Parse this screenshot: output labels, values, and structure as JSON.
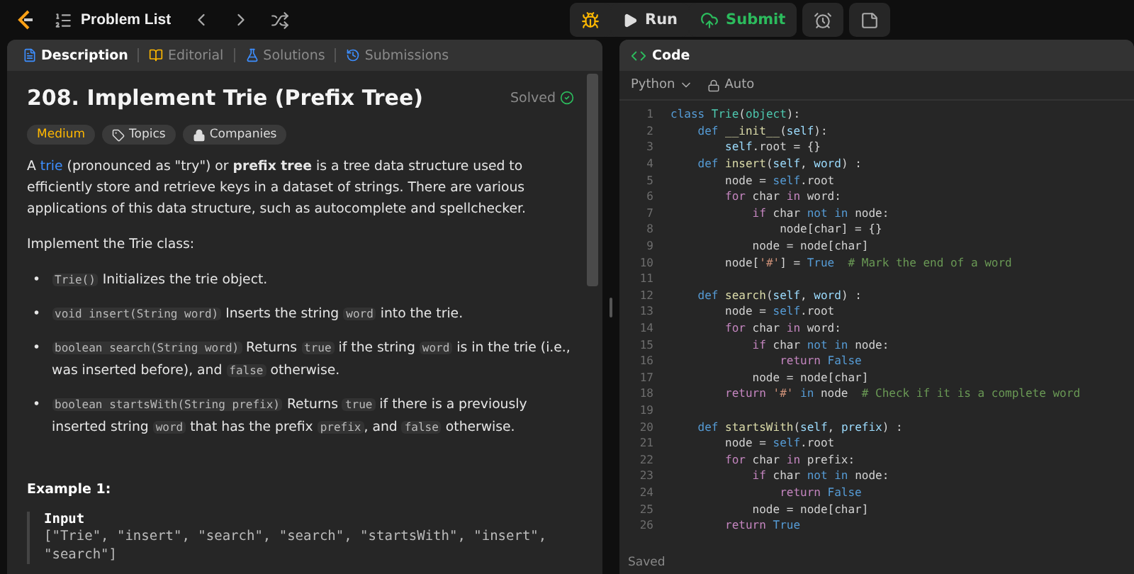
{
  "top_bar": {
    "problem_list": "Problem List",
    "run": "Run",
    "submit": "Submit"
  },
  "description_panel": {
    "tabs": [
      {
        "label": "Description",
        "selected": true
      },
      {
        "label": "Editorial",
        "selected": false
      },
      {
        "label": "Solutions",
        "selected": false
      },
      {
        "label": "Submissions",
        "selected": false
      }
    ],
    "title": "208. Implement Trie (Prefix Tree)",
    "status": "Solved",
    "tags": [
      {
        "label": "Medium",
        "kind": "difficulty"
      },
      {
        "label": "Topics",
        "kind": "topics"
      },
      {
        "label": "Companies",
        "kind": "companies"
      }
    ],
    "intro": [
      {
        "text": "A "
      },
      {
        "text": "trie",
        "kind": "link"
      },
      {
        "text": " (pronounced as \"try\") or "
      },
      {
        "text": "prefix tree",
        "kind": "bold"
      },
      {
        "text": " is a tree data structure used to efficiently store and retrieve keys in a dataset of strings. There are various applications of this data structure, such as autocomplete and spellchecker."
      }
    ],
    "implement_text": "Implement the Trie class:",
    "bullets": [
      {
        "marker": "•",
        "parts": [
          {
            "text": "Trie()",
            "kind": "code"
          },
          {
            "text": " Initializes the trie object."
          }
        ]
      },
      {
        "marker": "•",
        "parts": [
          {
            "text": "void insert(String word)",
            "kind": "code"
          },
          {
            "text": " Inserts the string "
          },
          {
            "text": "word",
            "kind": "code"
          },
          {
            "text": " into the trie."
          }
        ]
      },
      {
        "marker": "•",
        "parts": [
          {
            "text": "boolean search(String word)",
            "kind": "code"
          },
          {
            "text": " Returns "
          },
          {
            "text": "true",
            "kind": "code"
          },
          {
            "text": " if the string "
          },
          {
            "text": "word",
            "kind": "code"
          },
          {
            "text": " is in the trie (i.e., was inserted before), and "
          },
          {
            "text": "false",
            "kind": "code"
          },
          {
            "text": " otherwise."
          }
        ]
      },
      {
        "marker": "•",
        "parts": [
          {
            "text": "boolean startsWith(String prefix)",
            "kind": "code"
          },
          {
            "text": " Returns "
          },
          {
            "text": "true",
            "kind": "code"
          },
          {
            "text": " if there is a previously inserted string "
          },
          {
            "text": "word",
            "kind": "code"
          },
          {
            "text": " that has the prefix "
          },
          {
            "text": "prefix",
            "kind": "code"
          },
          {
            "text": ", and "
          },
          {
            "text": "false",
            "kind": "code"
          },
          {
            "text": " otherwise."
          }
        ]
      }
    ],
    "example": {
      "heading": "Example 1:",
      "input_label": "Input",
      "input_lines": [
        "[\"Trie\", \"insert\", \"search\", \"search\", \"startsWith\", \"insert\",",
        "\"search\"]"
      ]
    }
  },
  "code_panel": {
    "title": "Code",
    "language": "Python",
    "mode": "Auto",
    "status": "Saved",
    "lines": [
      {
        "n": "1",
        "tokens": [
          {
            "kind": "kw",
            "text": "class "
          },
          {
            "kind": "cls",
            "text": "Trie"
          },
          {
            "kind": "p",
            "text": "("
          },
          {
            "kind": "cls",
            "text": "object"
          },
          {
            "kind": "p",
            "text": "):"
          }
        ]
      },
      {
        "n": "2",
        "tokens": [
          {
            "kind": "kw",
            "text": "    def "
          },
          {
            "kind": "fn",
            "text": "__init__"
          },
          {
            "kind": "p",
            "text": "("
          },
          {
            "kind": "var",
            "text": "self"
          },
          {
            "kind": "p",
            "text": "):"
          }
        ]
      },
      {
        "n": "3",
        "tokens": [
          {
            "kind": "var",
            "text": "        self"
          },
          {
            "kind": "p",
            "text": ".root = {}"
          }
        ]
      },
      {
        "n": "4",
        "tokens": [
          {
            "kind": "kw",
            "text": "    def "
          },
          {
            "kind": "fn",
            "text": "insert"
          },
          {
            "kind": "p",
            "text": "("
          },
          {
            "kind": "var",
            "text": "self"
          },
          {
            "kind": "p",
            "text": ", "
          },
          {
            "kind": "var",
            "text": "word"
          },
          {
            "kind": "p",
            "text": ") :"
          }
        ]
      },
      {
        "n": "5",
        "tokens": [
          {
            "kind": "p",
            "text": "        node = "
          },
          {
            "kind": "kw",
            "text": "self"
          },
          {
            "kind": "p",
            "text": ".root"
          }
        ]
      },
      {
        "n": "6",
        "tokens": [
          {
            "kind": "ctl",
            "text": "        for"
          },
          {
            "kind": "p",
            "text": " char "
          },
          {
            "kind": "ctl",
            "text": "in"
          },
          {
            "kind": "p",
            "text": " word:"
          }
        ]
      },
      {
        "n": "7",
        "tokens": [
          {
            "kind": "ctl",
            "text": "            if"
          },
          {
            "kind": "p",
            "text": " char "
          },
          {
            "kind": "kw",
            "text": "not in"
          },
          {
            "kind": "p",
            "text": " node:"
          }
        ]
      },
      {
        "n": "8",
        "tokens": [
          {
            "kind": "p",
            "text": "                node[char] = {}"
          }
        ]
      },
      {
        "n": "9",
        "tokens": [
          {
            "kind": "p",
            "text": "            node = node[char]"
          }
        ]
      },
      {
        "n": "10",
        "tokens": [
          {
            "kind": "p",
            "text": "        node["
          },
          {
            "kind": "str",
            "text": "'#'"
          },
          {
            "kind": "p",
            "text": "] = "
          },
          {
            "kind": "kw",
            "text": "True"
          },
          {
            "kind": "com",
            "text": "  # Mark the end of a word"
          }
        ]
      },
      {
        "n": "11"
      },
      {
        "n": "12",
        "tokens": [
          {
            "kind": "kw",
            "text": "    def "
          },
          {
            "kind": "fn",
            "text": "search"
          },
          {
            "kind": "p",
            "text": "("
          },
          {
            "kind": "var",
            "text": "self"
          },
          {
            "kind": "p",
            "text": ", "
          },
          {
            "kind": "var",
            "text": "word"
          },
          {
            "kind": "p",
            "text": ") :"
          }
        ]
      },
      {
        "n": "13",
        "tokens": [
          {
            "kind": "p",
            "text": "        node = "
          },
          {
            "kind": "kw",
            "text": "self"
          },
          {
            "kind": "p",
            "text": ".root"
          }
        ]
      },
      {
        "n": "14",
        "tokens": [
          {
            "kind": "ctl",
            "text": "        for"
          },
          {
            "kind": "p",
            "text": " char "
          },
          {
            "kind": "ctl",
            "text": "in"
          },
          {
            "kind": "p",
            "text": " word:"
          }
        ]
      },
      {
        "n": "15",
        "tokens": [
          {
            "kind": "ctl",
            "text": "            if"
          },
          {
            "kind": "p",
            "text": " char "
          },
          {
            "kind": "kw",
            "text": "not in"
          },
          {
            "kind": "p",
            "text": " node:"
          }
        ]
      },
      {
        "n": "16",
        "tokens": [
          {
            "kind": "ctl",
            "text": "                return"
          },
          {
            "kind": "kw",
            "text": " False"
          }
        ]
      },
      {
        "n": "17",
        "tokens": [
          {
            "kind": "p",
            "text": "            node = node[char]"
          }
        ]
      },
      {
        "n": "18",
        "tokens": [
          {
            "kind": "ctl",
            "text": "        return"
          },
          {
            "kind": "str",
            "text": " '#'"
          },
          {
            "kind": "kw",
            "text": " in"
          },
          {
            "kind": "p",
            "text": " node"
          },
          {
            "kind": "com",
            "text": "  # Check if it is a complete word"
          }
        ]
      },
      {
        "n": "19"
      },
      {
        "n": "20",
        "tokens": [
          {
            "kind": "kw",
            "text": "    def "
          },
          {
            "kind": "fn",
            "text": "startsWith"
          },
          {
            "kind": "p",
            "text": "("
          },
          {
            "kind": "var",
            "text": "self"
          },
          {
            "kind": "p",
            "text": ", "
          },
          {
            "kind": "var",
            "text": "prefix"
          },
          {
            "kind": "p",
            "text": ") :"
          }
        ]
      },
      {
        "n": "21",
        "tokens": [
          {
            "kind": "p",
            "text": "        node = "
          },
          {
            "kind": "kw",
            "text": "self"
          },
          {
            "kind": "p",
            "text": ".root"
          }
        ]
      },
      {
        "n": "22",
        "tokens": [
          {
            "kind": "ctl",
            "text": "        for"
          },
          {
            "kind": "p",
            "text": " char "
          },
          {
            "kind": "ctl",
            "text": "in"
          },
          {
            "kind": "p",
            "text": " prefix:"
          }
        ]
      },
      {
        "n": "23",
        "tokens": [
          {
            "kind": "ctl",
            "text": "            if"
          },
          {
            "kind": "p",
            "text": " char "
          },
          {
            "kind": "kw",
            "text": "not in"
          },
          {
            "kind": "p",
            "text": " node:"
          }
        ]
      },
      {
        "n": "24",
        "tokens": [
          {
            "kind": "ctl",
            "text": "                return"
          },
          {
            "kind": "kw",
            "text": " False"
          }
        ]
      },
      {
        "n": "25",
        "tokens": [
          {
            "kind": "p",
            "text": "            node = node[char]"
          }
        ]
      },
      {
        "n": "26",
        "tokens": [
          {
            "kind": "ctl",
            "text": "        return"
          },
          {
            "kind": "kw",
            "text": " True"
          }
        ]
      }
    ]
  }
}
